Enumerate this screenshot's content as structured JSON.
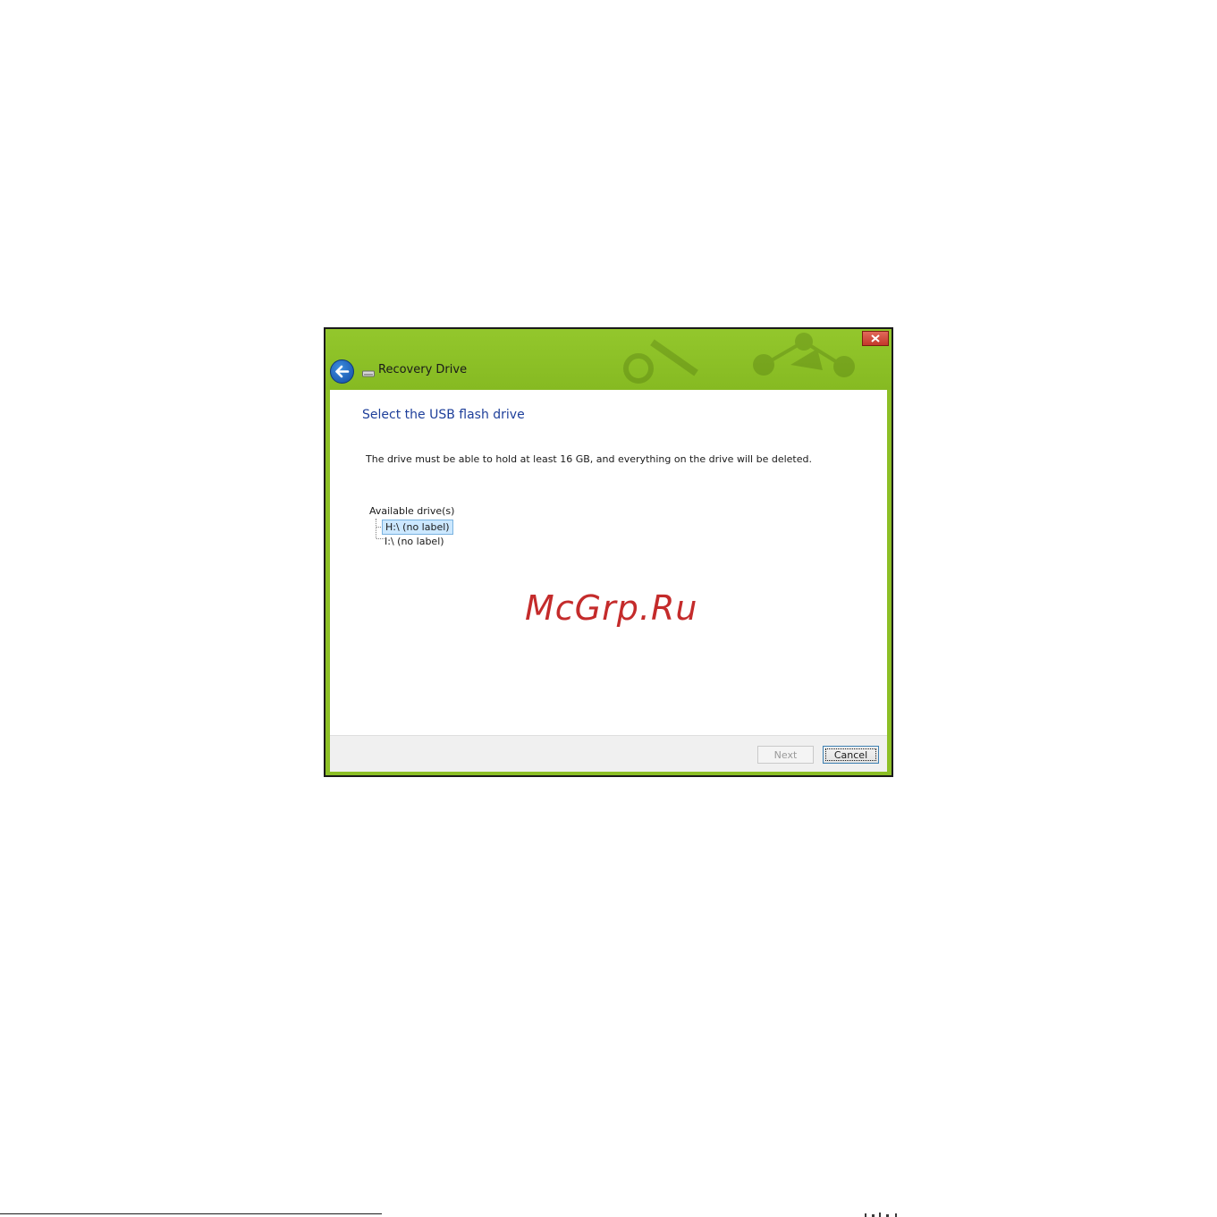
{
  "window": {
    "title": "Recovery Drive",
    "close_label": "Close"
  },
  "icons": {
    "back": "back-arrow-icon",
    "drive": "usb-drive-icon",
    "close": "close-icon"
  },
  "content": {
    "heading": "Select the USB flash drive",
    "description": "The drive must be able to hold at least 16 GB, and everything on the drive will be deleted.",
    "tree": {
      "root_label": "Available drive(s)",
      "items": [
        {
          "label": "H:\\ (no label)",
          "selected": true
        },
        {
          "label": "I:\\ (no label)",
          "selected": false
        }
      ]
    }
  },
  "watermark": "McGrp.Ru",
  "footer": {
    "next_label": "Next",
    "cancel_label": "Cancel"
  },
  "colors": {
    "accent_green": "#8cbf26",
    "heading_blue": "#1e3f9a",
    "watermark_red": "#c42b2b",
    "selection_bg": "#cce8ff"
  }
}
